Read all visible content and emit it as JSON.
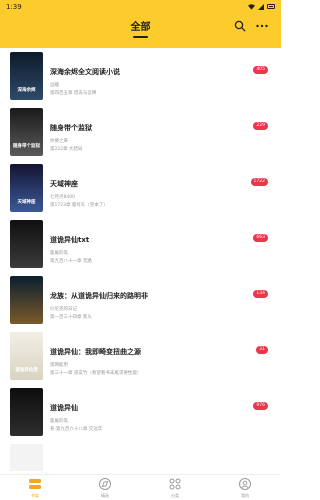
{
  "status_bar": {
    "time": "1:39"
  },
  "header": {
    "title": "全部",
    "background": "#fccc2c",
    "search_icon": "search-icon",
    "more_icon": "more-dots-icon"
  },
  "books": [
    {
      "title": "深海余烬全文阅读小说",
      "author": "远瞳",
      "chapter": "第四百五章 借去与吾释",
      "badge": "405",
      "cover_text": "深海余烬",
      "cover_colors": [
        "#0d1b2a",
        "#2e4a6b"
      ]
    },
    {
      "title": "随身带个监狱",
      "author": "你要之来",
      "chapter": "第222章 大结局",
      "badge": "229",
      "cover_text": "随身带个监狱",
      "cover_colors": [
        "#1a1a1a",
        "#5a5a5a"
      ]
    },
    {
      "title": "天域神座",
      "author": "七月点8400",
      "chapter": "第1723章 曼有礼（完本了）",
      "badge": "1722",
      "cover_text": "天域神座",
      "cover_colors": [
        "#141432",
        "#3b5998"
      ]
    },
    {
      "title": "道诡异仙txt",
      "author": "狐尾的笔",
      "chapter": "第九百八十一章 无路",
      "badge": "663",
      "cover_text": "",
      "cover_colors": [
        "#101010",
        "#3a3a3a"
      ]
    },
    {
      "title": "龙族：从道诡异仙归来的路明非",
      "author": "价尼克的日记",
      "chapter": "第一百三十四章 客头",
      "badge": "134",
      "cover_text": "",
      "cover_colors": [
        "#0b1f2f",
        "#7a5a2a"
      ]
    },
    {
      "title": "道诡异仙：我即畸变扭曲之源",
      "author": "第网能用",
      "chapter": "第三十一章 道玄竹（希望看书末尾求要性能）",
      "badge": "31",
      "cover_text": "道诡异仙我",
      "cover_colors": [
        "#f2efe6",
        "#d9d3c0"
      ]
    },
    {
      "title": "道诡异仙",
      "author": "狐尾的笔",
      "chapter": "系·第九百六十八章 交远年",
      "badge": "976",
      "cover_text": "",
      "cover_colors": [
        "#0e0e0e",
        "#2d2d2d"
      ]
    }
  ],
  "nav": [
    {
      "label": "书架",
      "icon": "bookshelf-icon",
      "active": true
    },
    {
      "label": "精选",
      "icon": "compass-icon",
      "active": false
    },
    {
      "label": "分类",
      "icon": "category-grid-icon",
      "active": false
    },
    {
      "label": "我的",
      "icon": "profile-icon",
      "active": false
    }
  ]
}
